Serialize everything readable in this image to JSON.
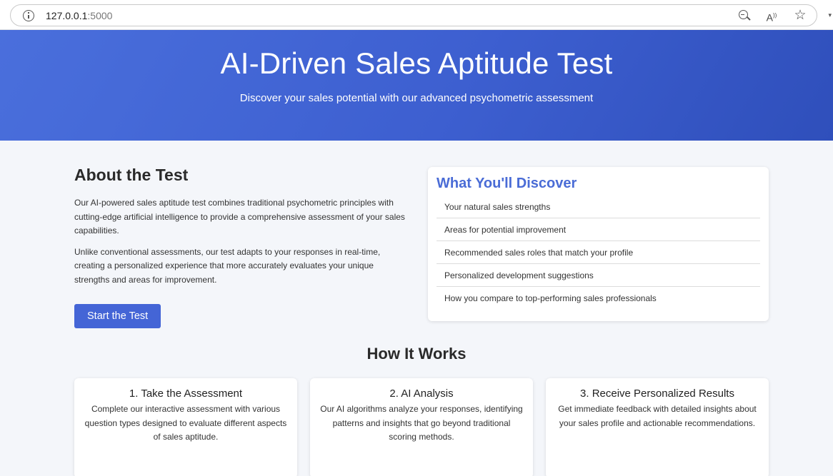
{
  "browser": {
    "url_host": "127.0.0.1",
    "url_port": ":5000"
  },
  "hero": {
    "title": "AI-Driven Sales Aptitude Test",
    "subtitle": "Discover your sales potential with our advanced psychometric assessment"
  },
  "about": {
    "heading": "About the Test",
    "paragraph1": "Our AI-powered sales aptitude test combines traditional psychometric principles with cutting-edge artificial intelligence to provide a comprehensive assessment of your sales capabilities.",
    "paragraph2": "Unlike conventional assessments, our test adapts to your responses in real-time, creating a personalized experience that more accurately evaluates your unique strengths and areas for improvement.",
    "button_label": "Start the Test"
  },
  "discover": {
    "heading": "What You'll Discover",
    "items": [
      "Your natural sales strengths",
      "Areas for potential improvement",
      "Recommended sales roles that match your profile",
      "Personalized development suggestions",
      "How you compare to top-performing sales professionals"
    ]
  },
  "how": {
    "heading": "How It Works",
    "steps": [
      {
        "title": "1. Take the Assessment",
        "text": "Complete our interactive assessment with various question types designed to evaluate different aspects of sales aptitude."
      },
      {
        "title": "2. AI Analysis",
        "text": "Our AI algorithms analyze your responses, identifying patterns and insights that go beyond traditional scoring methods."
      },
      {
        "title": "3. Receive Personalized Results",
        "text": "Get immediate feedback with detailed insights about your sales profile and actionable recommendations."
      }
    ]
  }
}
